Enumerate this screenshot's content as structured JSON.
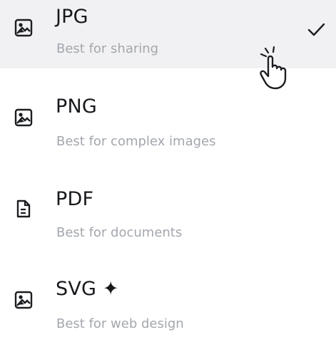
{
  "menu": {
    "options": [
      {
        "label": "JPG",
        "description": "Best for sharing",
        "icon": "image-file-icon",
        "selected": true
      },
      {
        "label": "PNG",
        "description": "Best for complex images",
        "icon": "image-file-icon",
        "selected": false
      },
      {
        "label": "PDF",
        "description": "Best for documents",
        "icon": "document-file-icon",
        "selected": false
      },
      {
        "label": "SVG ✦",
        "description": "Best for web design",
        "icon": "image-file-icon",
        "selected": false
      }
    ],
    "selected_icon": "checkmark-icon",
    "highlight_color": "#f1f1f3",
    "label_color": "#17191c",
    "description_color": "#a3a7ad"
  },
  "cursor": {
    "icon": "hand-pointer-cursor-icon"
  }
}
